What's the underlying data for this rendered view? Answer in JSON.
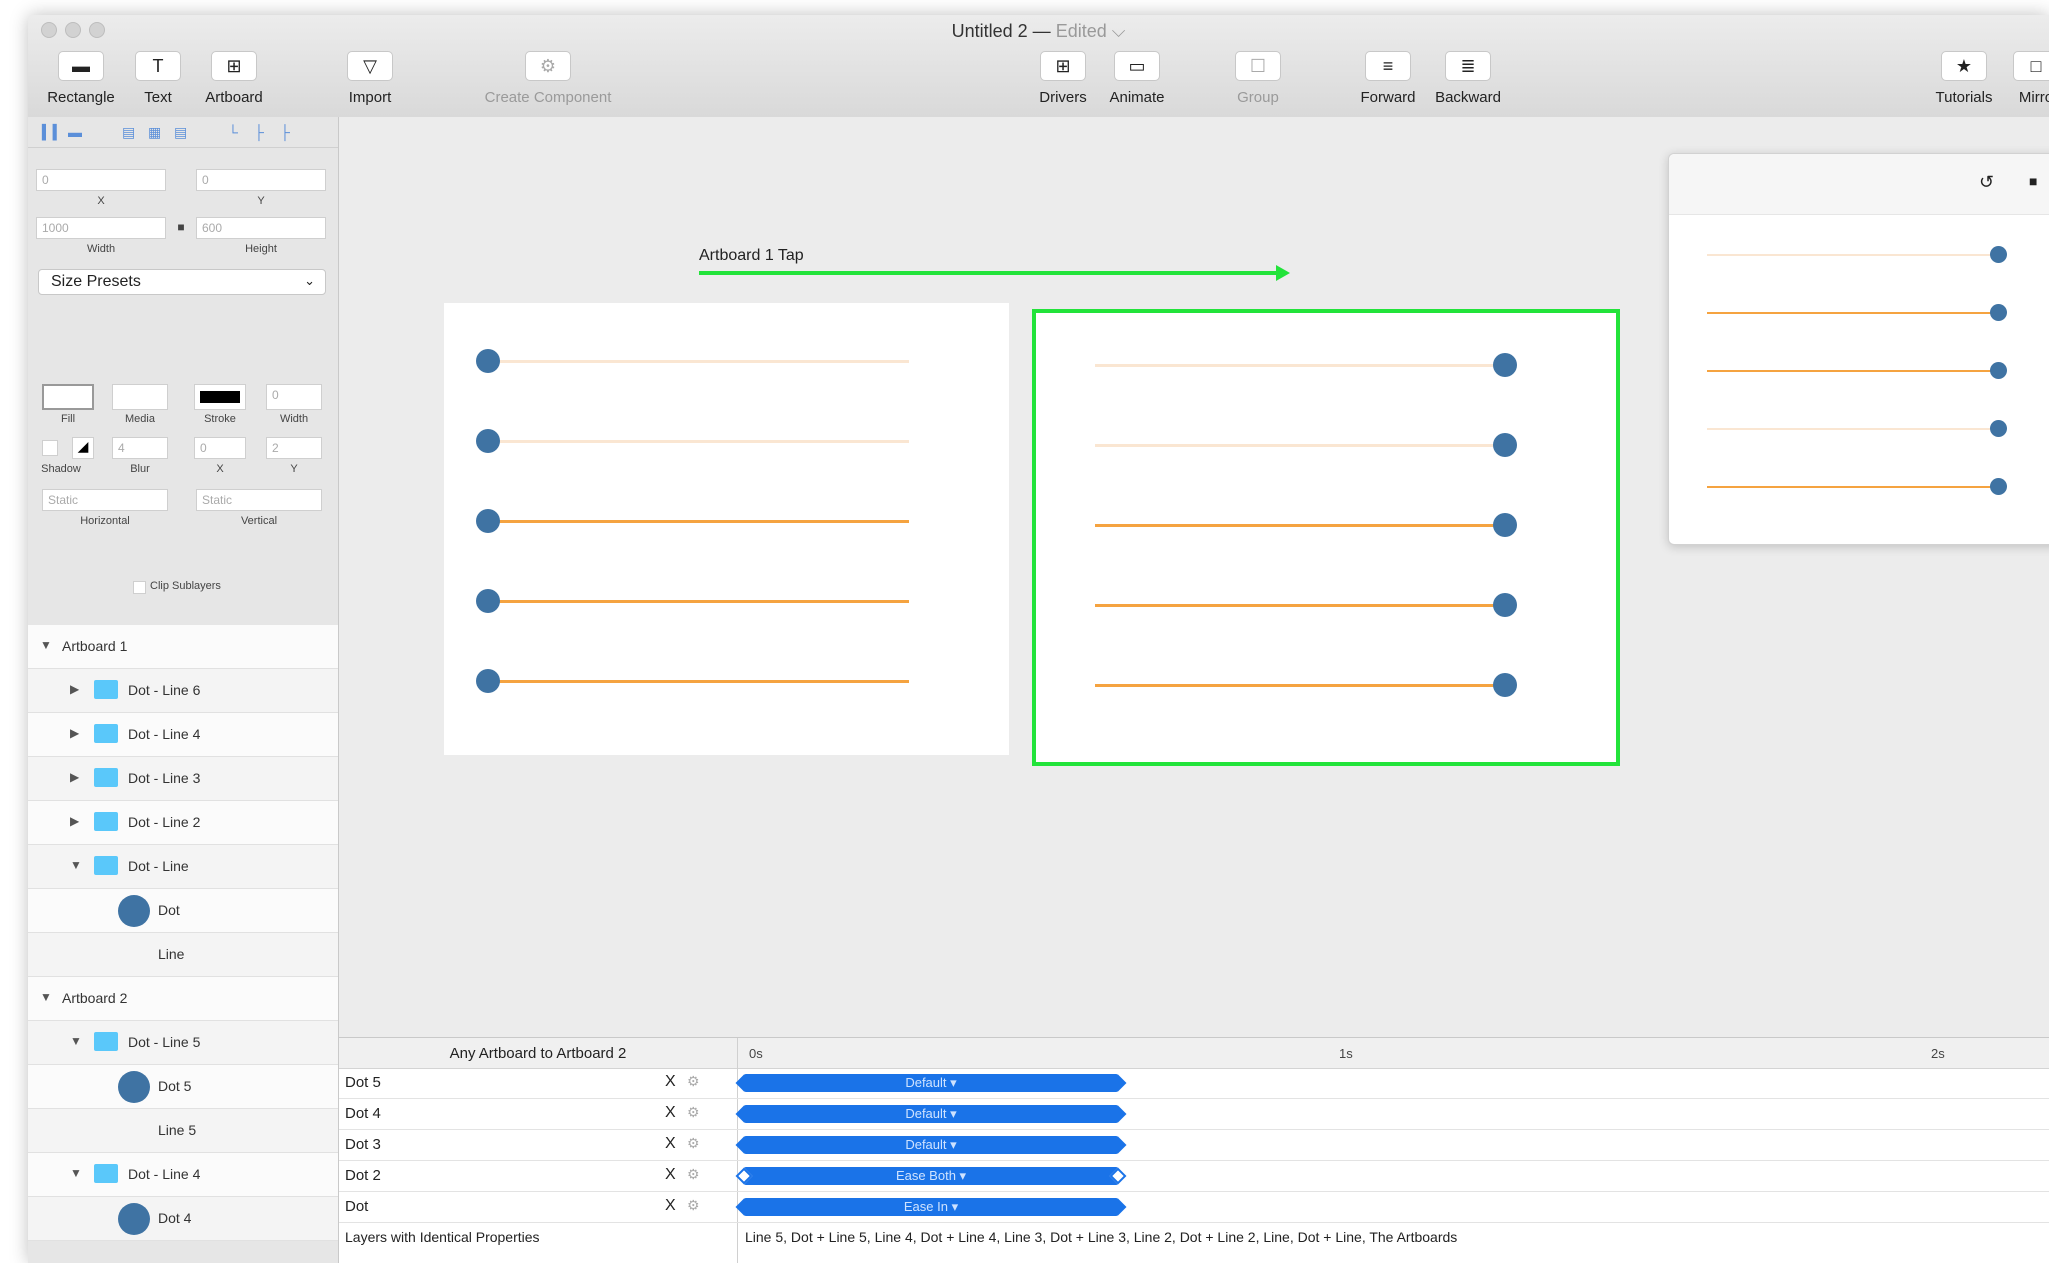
{
  "window": {
    "title": "Untitled 2",
    "title_sep": " — ",
    "edited": "Edited ⌵"
  },
  "toolbar": {
    "rectangle": "Rectangle",
    "text": "Text",
    "artboard": "Artboard",
    "import": "Import",
    "create_component": "Create Component",
    "drivers": "Drivers",
    "animate": "Animate",
    "group": "Group",
    "forward": "Forward",
    "backward": "Backward",
    "tutorials": "Tutorials",
    "mirror": "Mirro",
    "icons": {
      "rectangle": "▬",
      "text": "T",
      "artboard": "⊞",
      "import": "▽",
      "create_component": "⚙",
      "drivers": "⊞",
      "animate": "▭",
      "group": "☐",
      "forward": "≡",
      "backward": "≣",
      "tutorials": "★",
      "mirror": "□"
    }
  },
  "inspector": {
    "x_value": "0",
    "y_value": "0",
    "x_label": "X",
    "y_label": "Y",
    "width_value": "1000",
    "height_value": "600",
    "width_label": "Width",
    "height_label": "Height",
    "size_presets": "Size Presets",
    "fill_label": "Fill",
    "media_label": "Media",
    "stroke_label": "Stroke",
    "stroke_width_value": "0",
    "stroke_width_label": "Width",
    "shadow_label": "Shadow",
    "blur_label": "Blur",
    "blur_value": "4",
    "shadow_x_value": "0",
    "shadow_y_value": "2",
    "shadow_x_label": "X",
    "shadow_y_label": "Y",
    "horizontal_value": "Static",
    "vertical_value": "Static",
    "horizontal_label": "Horizontal",
    "vertical_label": "Vertical",
    "clip_sublayers": "Clip Sublayers"
  },
  "layers": [
    {
      "label": "Artboard 1",
      "kind": "artboard"
    },
    {
      "label": "Dot - Line 6",
      "kind": "group"
    },
    {
      "label": "Dot - Line 4",
      "kind": "group"
    },
    {
      "label": "Dot - Line 3",
      "kind": "group"
    },
    {
      "label": "Dot - Line 2",
      "kind": "group"
    },
    {
      "label": "Dot - Line",
      "kind": "group-open"
    },
    {
      "label": "Dot",
      "kind": "dot"
    },
    {
      "label": "Line",
      "kind": "line"
    },
    {
      "label": "Artboard 2",
      "kind": "artboard"
    },
    {
      "label": "Dot - Line 5",
      "kind": "group-open"
    },
    {
      "label": "Dot 5",
      "kind": "dot"
    },
    {
      "label": "Line 5",
      "kind": "line"
    },
    {
      "label": "Dot - Line 4",
      "kind": "group-open"
    },
    {
      "label": "Dot 4",
      "kind": "dot"
    }
  ],
  "canvas": {
    "connection_label": "Artboard 1 Tap"
  },
  "preview": {
    "undo_icon": "↺",
    "camera_icon": "■"
  },
  "timeline": {
    "transition_title": "Any Artboard to Artboard 2",
    "ticks": [
      "0s",
      "1s",
      "2s"
    ],
    "rows": [
      {
        "name": "Dot 5",
        "curve": "Default ▾"
      },
      {
        "name": "Dot 4",
        "curve": "Default ▾"
      },
      {
        "name": "Dot 3",
        "curve": "Default ▾"
      },
      {
        "name": "Dot 2",
        "curve": "Ease Both ▾"
      },
      {
        "name": "Dot",
        "curve": "Ease In ▾"
      }
    ],
    "identical_label": "Layers with Identical Properties",
    "identical_value": "Line 5, Dot + Line 5, Line 4, Dot + Line 4, Line 3, Dot + Line 3, Line 2, Dot + Line 2, Line, Dot + Line, The Artboards",
    "remove_symbol": "X",
    "gear_symbol": "⚙"
  },
  "colors": {
    "dot": "#3f73a3",
    "line": "#f5a340",
    "selection": "#22e33a",
    "timeline_bar": "#1a73e8"
  }
}
